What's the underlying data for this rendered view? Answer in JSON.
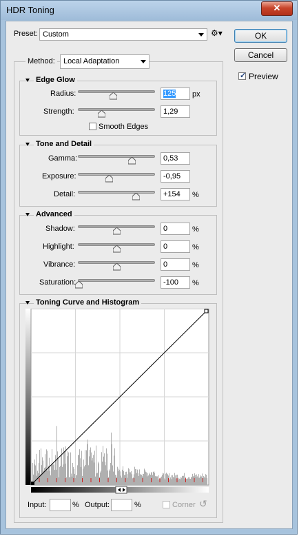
{
  "window": {
    "title": "HDR Toning",
    "close_glyph": "✕"
  },
  "preset": {
    "label": "Preset:",
    "value": "Custom",
    "gear_glyph": "⚙▾"
  },
  "buttons": {
    "ok": "OK",
    "cancel": "Cancel"
  },
  "preview": {
    "label": "Preview",
    "checked": true
  },
  "method": {
    "label": "Method:",
    "value": "Local Adaptation"
  },
  "edge_glow": {
    "title": "Edge Glow",
    "radius": {
      "label": "Radius:",
      "value": "125",
      "unit": "px",
      "slider": 0.45
    },
    "strength": {
      "label": "Strength:",
      "value": "1,29",
      "unit": "",
      "slider": 0.3
    },
    "smooth_edges": {
      "label": "Smooth Edges",
      "checked": false
    }
  },
  "tone_detail": {
    "title": "Tone and Detail",
    "gamma": {
      "label": "Gamma:",
      "value": "0,53",
      "unit": "",
      "slider": 0.7
    },
    "exposure": {
      "label": "Exposure:",
      "value": "-0,95",
      "unit": "",
      "slider": 0.4
    },
    "detail": {
      "label": "Detail:",
      "value": "+154",
      "unit": "%",
      "slider": 0.76
    }
  },
  "advanced": {
    "title": "Advanced",
    "shadow": {
      "label": "Shadow:",
      "value": "0",
      "unit": "%",
      "slider": 0.5
    },
    "highlight": {
      "label": "Highlight:",
      "value": "0",
      "unit": "%",
      "slider": 0.5
    },
    "vibrance": {
      "label": "Vibrance:",
      "value": "0",
      "unit": "%",
      "slider": 0.5
    },
    "saturation": {
      "label": "Saturation:",
      "value": "-100",
      "unit": "%",
      "slider": 0.0
    }
  },
  "curve": {
    "title": "Toning Curve and Histogram",
    "input_label": "Input:",
    "input_value": "",
    "output_label": "Output:",
    "output_value": "",
    "percent": "%",
    "corner_label": "Corner",
    "reset_glyph": "↺"
  },
  "colors": {
    "accent": "#3399ff",
    "title_bar": "#a7c3dd",
    "close": "#c8452b",
    "marker": "#d02020"
  }
}
